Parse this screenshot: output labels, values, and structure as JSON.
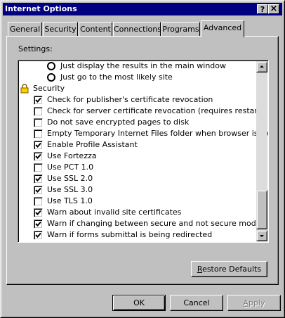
{
  "window": {
    "title": "Internet Options"
  },
  "title_buttons": {
    "help": "?",
    "close": "×"
  },
  "tabs": [
    {
      "label": "General"
    },
    {
      "label": "Security"
    },
    {
      "label": "Content"
    },
    {
      "label": "Connections"
    },
    {
      "label": "Programs"
    },
    {
      "label": "Advanced",
      "active": true
    }
  ],
  "settings_label": "Settings:",
  "settings": [
    {
      "type": "radio",
      "label": "Just display the results in the main window",
      "selected": false
    },
    {
      "type": "radio",
      "label": "Just go to the most likely site",
      "selected": false
    },
    {
      "type": "category",
      "label": "Security",
      "icon": "lock-icon"
    },
    {
      "type": "checkbox",
      "label": "Check for publisher's certificate revocation",
      "checked": true
    },
    {
      "type": "checkbox",
      "label": "Check for server certificate revocation (requires restart)",
      "checked": false
    },
    {
      "type": "checkbox",
      "label": "Do not save encrypted pages to disk",
      "checked": false
    },
    {
      "type": "checkbox",
      "label": "Empty Temporary Internet Files folder when browser is closed",
      "checked": false
    },
    {
      "type": "checkbox",
      "label": "Enable Profile Assistant",
      "checked": true
    },
    {
      "type": "checkbox",
      "label": "Use Fortezza",
      "checked": true
    },
    {
      "type": "checkbox",
      "label": "Use PCT 1.0",
      "checked": false
    },
    {
      "type": "checkbox",
      "label": "Use SSL 2.0",
      "checked": true
    },
    {
      "type": "checkbox",
      "label": "Use SSL 3.0",
      "checked": true
    },
    {
      "type": "checkbox",
      "label": "Use TLS 1.0",
      "checked": false
    },
    {
      "type": "checkbox",
      "label": "Warn about invalid site certificates",
      "checked": true
    },
    {
      "type": "checkbox",
      "label": "Warn if changing between secure and not secure mode",
      "checked": true
    },
    {
      "type": "checkbox",
      "label": "Warn if forms submittal is being redirected",
      "checked": true
    }
  ],
  "scrollbar": {
    "position": 0.98
  },
  "buttons": {
    "restore_defaults": {
      "accel": "R",
      "rest": "estore Defaults"
    },
    "ok": "OK",
    "cancel": "Cancel",
    "apply": {
      "accel": "A",
      "rest": "pply",
      "disabled": true
    }
  },
  "colors": {
    "titlebar": "#000080",
    "face": "#c0c0c0"
  }
}
